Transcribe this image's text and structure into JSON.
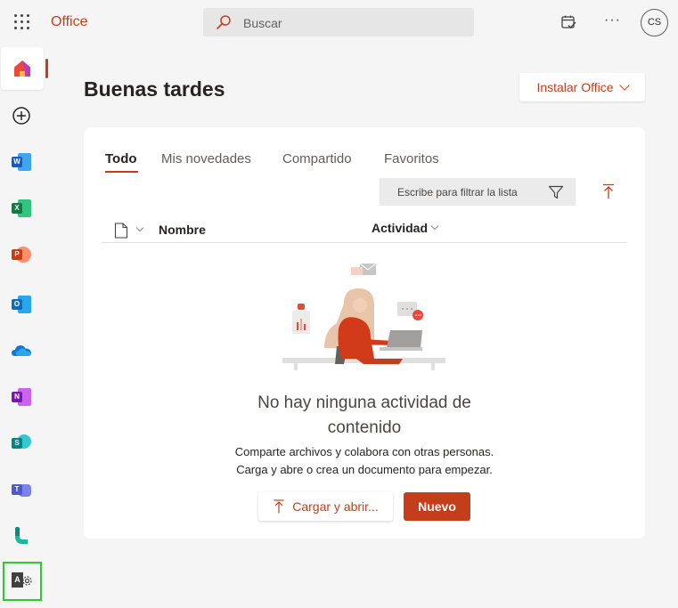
{
  "header": {
    "brand": "Office",
    "search_placeholder": "Buscar",
    "more_label": "···",
    "avatar_initials": "CS"
  },
  "rail": {
    "items": [
      {
        "name": "home",
        "icon": "home-icon"
      },
      {
        "name": "create",
        "icon": "plus-circle-icon"
      },
      {
        "name": "word",
        "icon": "word-icon",
        "letter": "W",
        "color": "#185abd"
      },
      {
        "name": "excel",
        "icon": "excel-icon",
        "letter": "X",
        "color": "#107c41"
      },
      {
        "name": "powerpoint",
        "icon": "powerpoint-icon",
        "letter": "P",
        "color": "#c43e1c"
      },
      {
        "name": "outlook",
        "icon": "outlook-icon",
        "letter": "O",
        "color": "#0f6cbd"
      },
      {
        "name": "onedrive",
        "icon": "onedrive-icon"
      },
      {
        "name": "onenote",
        "icon": "onenote-icon",
        "letter": "N",
        "color": "#7719aa"
      },
      {
        "name": "sharepoint",
        "icon": "sharepoint-icon",
        "letter": "S",
        "color": "#038387"
      },
      {
        "name": "teams",
        "icon": "teams-icon",
        "letter": "T",
        "color": "#5059c9"
      },
      {
        "name": "bookings",
        "icon": "bookings-icon"
      },
      {
        "name": "admin",
        "icon": "admin-icon",
        "letter": "A"
      }
    ]
  },
  "main": {
    "greeting": "Buenas tardes",
    "install_label": "Instalar Office",
    "tabs": [
      "Todo",
      "Mis novedades",
      "Compartido",
      "Favoritos"
    ],
    "active_tab": "Todo",
    "filter_placeholder": "Escribe para filtrar la lista",
    "columns": {
      "name": "Nombre",
      "activity": "Actividad"
    },
    "empty_title_line1": "No hay ninguna actividad de",
    "empty_title_line2": "contenido",
    "empty_sub_line1": "Comparte archivos y colabora con otras personas.",
    "empty_sub_line2": "Carga y abre o crea un documento para empezar.",
    "upload_label": "Cargar y abrir...",
    "new_label": "Nuevo"
  },
  "colors": {
    "accent": "#c43e1c",
    "background": "#f5f5f5",
    "card": "#ffffff",
    "highlight": "#31c931"
  }
}
